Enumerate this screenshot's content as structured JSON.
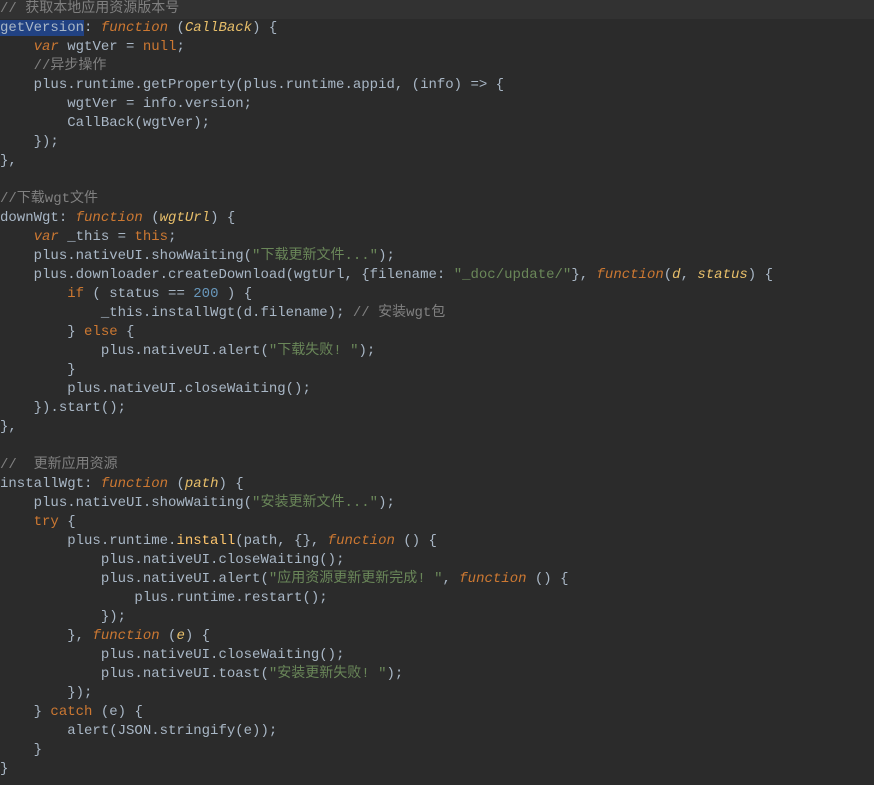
{
  "code": {
    "c_getversion_local": "// 获取本地应用资源版本号",
    "getVersion": "getVersion",
    "colon_sp": ": ",
    "kw_function": "function",
    "sp_lp": " (",
    "p_CallBack": "CallBack",
    "rp_sp_lb": ") {",
    "ind1": "    ",
    "ind2": "        ",
    "ind3": "            ",
    "ind4": "                ",
    "kw_var": "var",
    "sp": " ",
    "wgtVer_eq": "wgtVer = ",
    "kw_null": "null",
    "semi": ";",
    "c_async": "//异步操作",
    "plus_runtime_getProperty": "plus.runtime.getProperty(plus.runtime.appid, (info) => {",
    "wgtVer_assign": "wgtVer = info.version;",
    "CallBack_call": "CallBack(wgtVer);",
    "rb_rp_semi": "});",
    "rb_com": "},",
    "blank": "",
    "c_downwgt": "//下载wgt文件",
    "downWgt": "downWgt",
    "p_wgtUrl": "wgtUrl",
    "this_assign_pre": "_this = ",
    "kw_this": "this",
    "plus_nativeUI_showWaiting": "plus.nativeUI.showWaiting(",
    "str_download": "\"下载更新文件...\"",
    "rp_semi": ");",
    "plus_downloader_pre": "plus.downloader.createDownload(wgtUrl, {filename: ",
    "str_doc_update": "\"_doc/update/\"",
    "rb_com_sp": "}, ",
    "lp": "(",
    "p_d": "d",
    "com_sp": ", ",
    "p_status": "status",
    "kw_if": "if",
    "sp_lp2": " ( ",
    "status_eq": "status == ",
    "num_200": "200",
    "sp_rp_sp_lb": " ) {",
    "this_installWgt": "_this.installWgt(d.filename); ",
    "c_install_wgt": "// 安装wgt包",
    "rb_sp": "} ",
    "kw_else": "else",
    "sp_lb": " {",
    "plus_nativeUI_alert": "plus.nativeUI.alert(",
    "str_download_fail": "\"下载失败! \"",
    "rb": "}",
    "plus_nativeUI_closeWaiting": "plus.nativeUI.closeWaiting();",
    "rb_rp_start": "}).start();",
    "c_update_res": "//  更新应用资源",
    "installWgt": "installWgt",
    "p_path": "path",
    "str_install": "\"安装更新文件...\"",
    "kw_try": "try",
    "plus_runtime_install": "plus.runtime.",
    "fn_install": "install",
    "install_args": "(path, {}, ",
    "sp_lp_rp_sp_lb": " () {",
    "str_update_done": "\"应用资源更新更新完成! \"",
    "plus_runtime_restart": "plus.runtime.restart();",
    "p_e": "e",
    "plus_nativeUI_toast": "plus.nativeUI.toast(",
    "str_install_fail": "\"安装更新失败! \"",
    "kw_catch": "catch",
    "sp_lp3": " (",
    "e_rp_sp_lb": "e) {",
    "alert_json": "alert(JSON.stringify(e));"
  }
}
